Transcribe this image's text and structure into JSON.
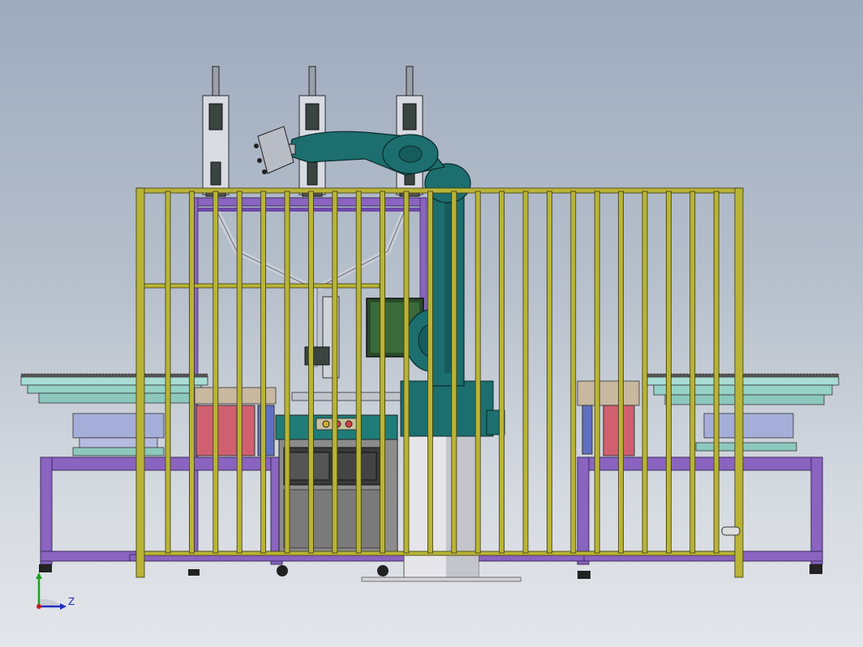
{
  "view": {
    "triad_axis_z": "Z",
    "colors": {
      "background_top": "#9eabbe",
      "fence": "#b9b436",
      "frame": "#7a54b0",
      "robot": "#1d6e6e",
      "table": "#8fd2c9",
      "cabinet": "#8a8a8a"
    }
  }
}
